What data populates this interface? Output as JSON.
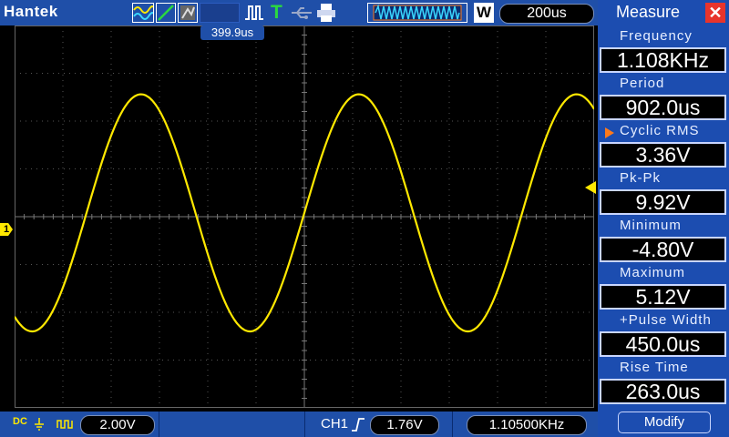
{
  "header": {
    "brand": "Hantek",
    "trigger_position": "399.9us",
    "memory_icon": "waveform-memory-icon",
    "window_mode": "W",
    "timebase": "200us"
  },
  "channel": {
    "marker": "1",
    "coupling": "DC",
    "volts_div": "2.00V",
    "trigger_source": "CH1",
    "trigger_level": "1.76V",
    "frequency_counter": "1.10500KHz"
  },
  "measure_panel": {
    "title": "Measure",
    "items": [
      {
        "label": "Frequency",
        "value": "1.108KHz"
      },
      {
        "label": "Period",
        "value": "902.0us"
      },
      {
        "label": "Cyclic RMS",
        "value": "3.36V"
      },
      {
        "label": "Pk-Pk",
        "value": "9.92V"
      },
      {
        "label": "Minimum",
        "value": "-4.80V"
      },
      {
        "label": "Maximum",
        "value": "5.12V"
      },
      {
        "label": "+Pulse Width",
        "value": "450.0us"
      },
      {
        "label": "Rise Time",
        "value": "263.0us"
      }
    ],
    "modify_label": "Modify"
  },
  "colors": {
    "waveform": "#ffe800",
    "panel": "#1c4db0",
    "bar": "#1f4fa8"
  }
}
